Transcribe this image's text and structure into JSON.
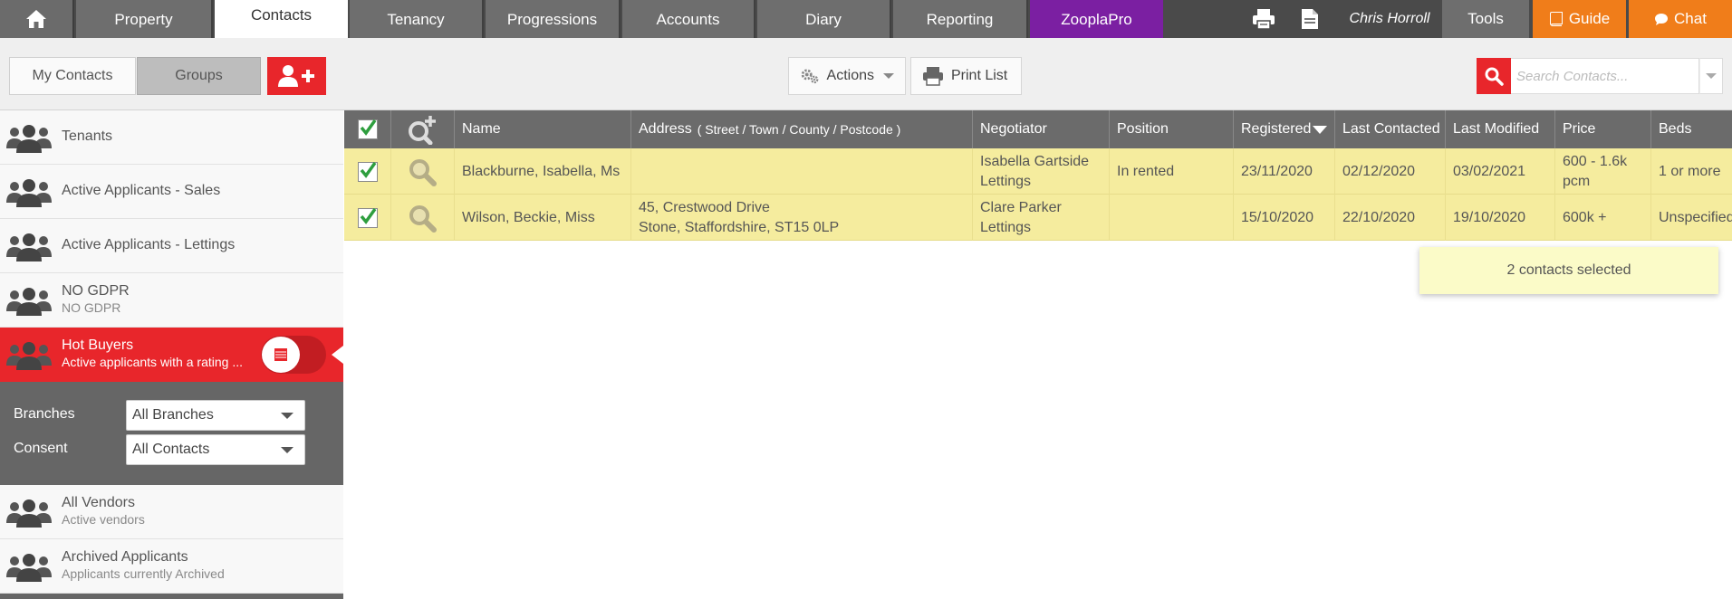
{
  "nav": {
    "tabs": [
      {
        "label": "Property"
      },
      {
        "label": "Contacts"
      },
      {
        "label": "Tenancy"
      },
      {
        "label": "Progressions"
      },
      {
        "label": "Accounts"
      },
      {
        "label": "Diary"
      },
      {
        "label": "Reporting"
      },
      {
        "label": "ZooplaPro"
      }
    ],
    "user": "Chris Horroll",
    "tools": "Tools",
    "guide": "Guide",
    "chat": "Chat"
  },
  "toolbar": {
    "my_contacts": "My Contacts",
    "groups": "Groups",
    "actions": "Actions",
    "print_list": "Print List",
    "search_placeholder": "Search Contacts..."
  },
  "sidebar": {
    "groups": [
      {
        "title": "Tenants",
        "subtitle": ""
      },
      {
        "title": "Active Applicants - Sales",
        "subtitle": ""
      },
      {
        "title": "Active Applicants - Lettings",
        "subtitle": ""
      },
      {
        "title": "NO GDPR",
        "subtitle": "NO GDPR"
      },
      {
        "title": "Hot Buyers",
        "subtitle": "Active applicants with a rating ..."
      },
      {
        "title": "All Vendors",
        "subtitle": "Active vendors"
      },
      {
        "title": "Archived Applicants",
        "subtitle": "Applicants currently Archived"
      }
    ],
    "filters": {
      "branches_label": "Branches",
      "branches_value": "All Branches",
      "consent_label": "Consent",
      "consent_value": "All Contacts"
    }
  },
  "table": {
    "headers": {
      "name": "Name",
      "address": "Address",
      "address_parts": "(  Street /  Town /  County /  Postcode )",
      "negotiator": "Negotiator",
      "position": "Position",
      "registered": "Registered",
      "last_contacted": "Last Contacted",
      "last_modified": "Last Modified",
      "price": "Price",
      "beds": "Beds"
    },
    "rows": [
      {
        "name": "Blackburne, Isabella, Ms",
        "address_line1": "",
        "address_line2": "",
        "negotiator_line1": "Isabella Gartside",
        "negotiator_line2": "Lettings",
        "position": "In rented",
        "registered": "23/11/2020",
        "last_contacted": "02/12/2020",
        "last_modified": "03/02/2021",
        "price_line1": "600 - 1.6k",
        "price_line2": "pcm",
        "beds": "1 or more"
      },
      {
        "name": "Wilson, Beckie, Miss",
        "address_line1": "45, Crestwood Drive",
        "address_line2": "Stone, Staffordshire, ST15 0LP",
        "negotiator_line1": "Clare Parker",
        "negotiator_line2": "Lettings",
        "position": "",
        "registered": "15/10/2020",
        "last_contacted": "22/10/2020",
        "last_modified": "19/10/2020",
        "price_line1": "600k +",
        "price_line2": "",
        "beds": "Unspecified"
      }
    ],
    "selection_note": "2 contacts selected"
  },
  "colors": {
    "accent_red": "#e8262b",
    "nav_orange": "#f07d1a",
    "zoopla_purple": "#7b1fa2",
    "row_highlight": "#f5ec9e",
    "check_green": "#2e9e3e"
  }
}
